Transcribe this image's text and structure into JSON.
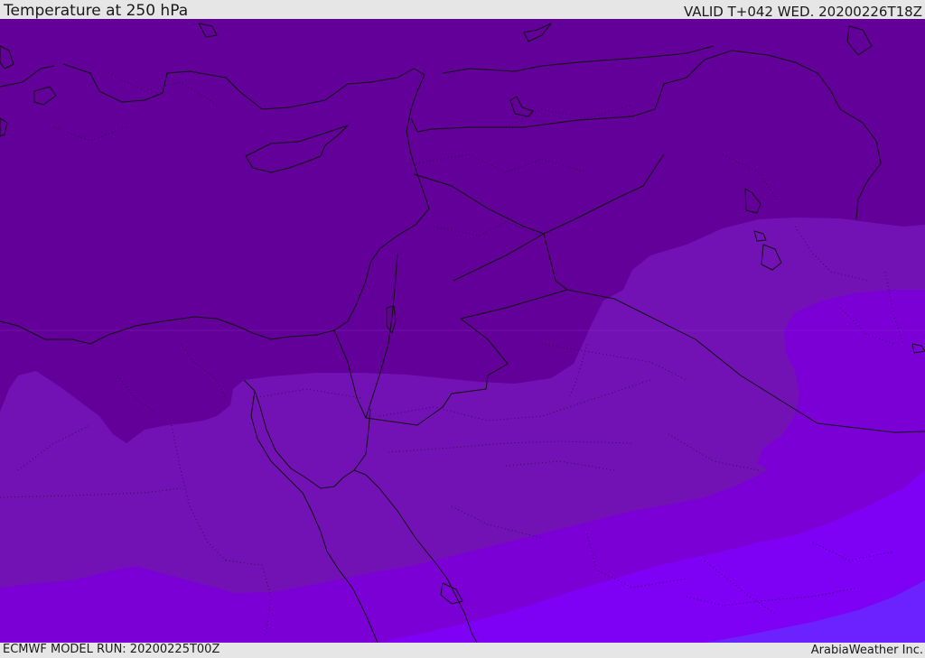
{
  "header": {
    "title": "Temperature at 250 hPa",
    "valid": "VALID T+042 WED. 20200226T18Z"
  },
  "footer": {
    "model_run": "ECMWF MODEL RUN: 20200225T00Z",
    "credit": "ArabiaWeather Inc."
  },
  "map": {
    "field": "Temperature at 250 hPa",
    "colors": {
      "coldest": "#620099",
      "cold": "#7212b5",
      "mid": "#7b00d6",
      "warm": "#7e00f5",
      "warmest": "#6b22ff",
      "coastline": "#111111",
      "border": "#111111"
    },
    "icons": {
      "coastline": "coastline-lines",
      "borders": "country-border-lines",
      "internal_boundaries": "dotted-boundary-lines"
    }
  }
}
